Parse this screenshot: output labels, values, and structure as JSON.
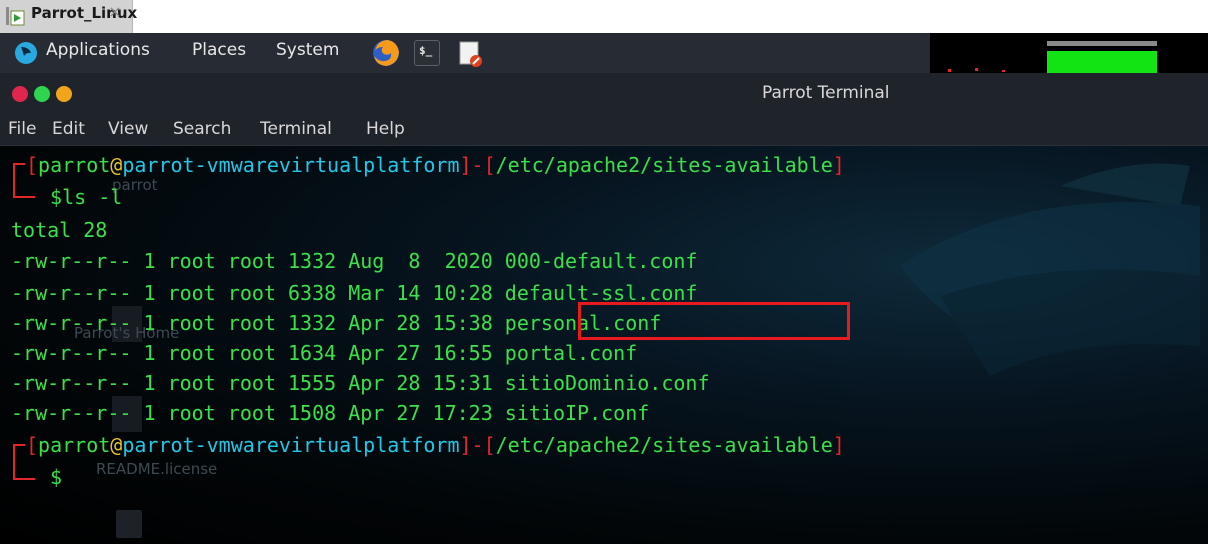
{
  "vm_tab": {
    "label": "Parrot_Linux",
    "close_glyph": "×"
  },
  "top_panel": {
    "menus": [
      "Applications",
      "Places",
      "System"
    ],
    "terminal_launcher_text": "$_"
  },
  "window": {
    "title": "Parrot Terminal"
  },
  "menubar": [
    "File",
    "Edit",
    "View",
    "Search",
    "Terminal",
    "Help"
  ],
  "desktop_ghosts": [
    "README.license",
    "parrot",
    "Parrot's Home"
  ],
  "terminal": {
    "prompt": {
      "user": "parrot",
      "at": "@",
      "host": "parrot-vmwarevirtualplatform",
      "path": "/etc/apache2/sites-available",
      "symbol": "$"
    },
    "command": "ls -l",
    "total": "total 28",
    "files": [
      {
        "perm": "-rw-r--r--",
        "links": "1",
        "owner": "root",
        "group": "root",
        "size": "1332",
        "month": "Aug",
        "day": " 8",
        "time": " 2020",
        "name": "000-default.conf"
      },
      {
        "perm": "-rw-r--r--",
        "links": "1",
        "owner": "root",
        "group": "root",
        "size": "6338",
        "month": "Mar",
        "day": "14",
        "time": "10:28",
        "name": "default-ssl.conf"
      },
      {
        "perm": "-rw-r--r--",
        "links": "1",
        "owner": "root",
        "group": "root",
        "size": "1332",
        "month": "Apr",
        "day": "28",
        "time": "15:38",
        "name": "personal.conf"
      },
      {
        "perm": "-rw-r--r--",
        "links": "1",
        "owner": "root",
        "group": "root",
        "size": "1634",
        "month": "Apr",
        "day": "27",
        "time": "16:55",
        "name": "portal.conf"
      },
      {
        "perm": "-rw-r--r--",
        "links": "1",
        "owner": "root",
        "group": "root",
        "size": "1555",
        "month": "Apr",
        "day": "28",
        "time": "15:31",
        "name": "sitioDominio.conf"
      },
      {
        "perm": "-rw-r--r--",
        "links": "1",
        "owner": "root",
        "group": "root",
        "size": "1508",
        "month": "Apr",
        "day": "27",
        "time": "17:23",
        "name": "sitioIP.conf"
      }
    ],
    "highlighted_file": "personal.conf"
  },
  "colors": {
    "prompt_bracket": "#e4262a",
    "prompt_user": "#3ce04a",
    "prompt_at": "#e8c22a",
    "prompt_host": "#22c8e8",
    "prompt_path": "#3ce04a",
    "listing_text": "#3ce04a",
    "highlight_border": "#e8191f",
    "mem_bar": "#12e312"
  },
  "icons": [
    "parrot-logo-icon",
    "firefox-icon",
    "terminal-icon",
    "text-editor-icon",
    "vm-tab-icon"
  ],
  "system_monitor": {
    "memory_usage_fraction": 1.0
  }
}
